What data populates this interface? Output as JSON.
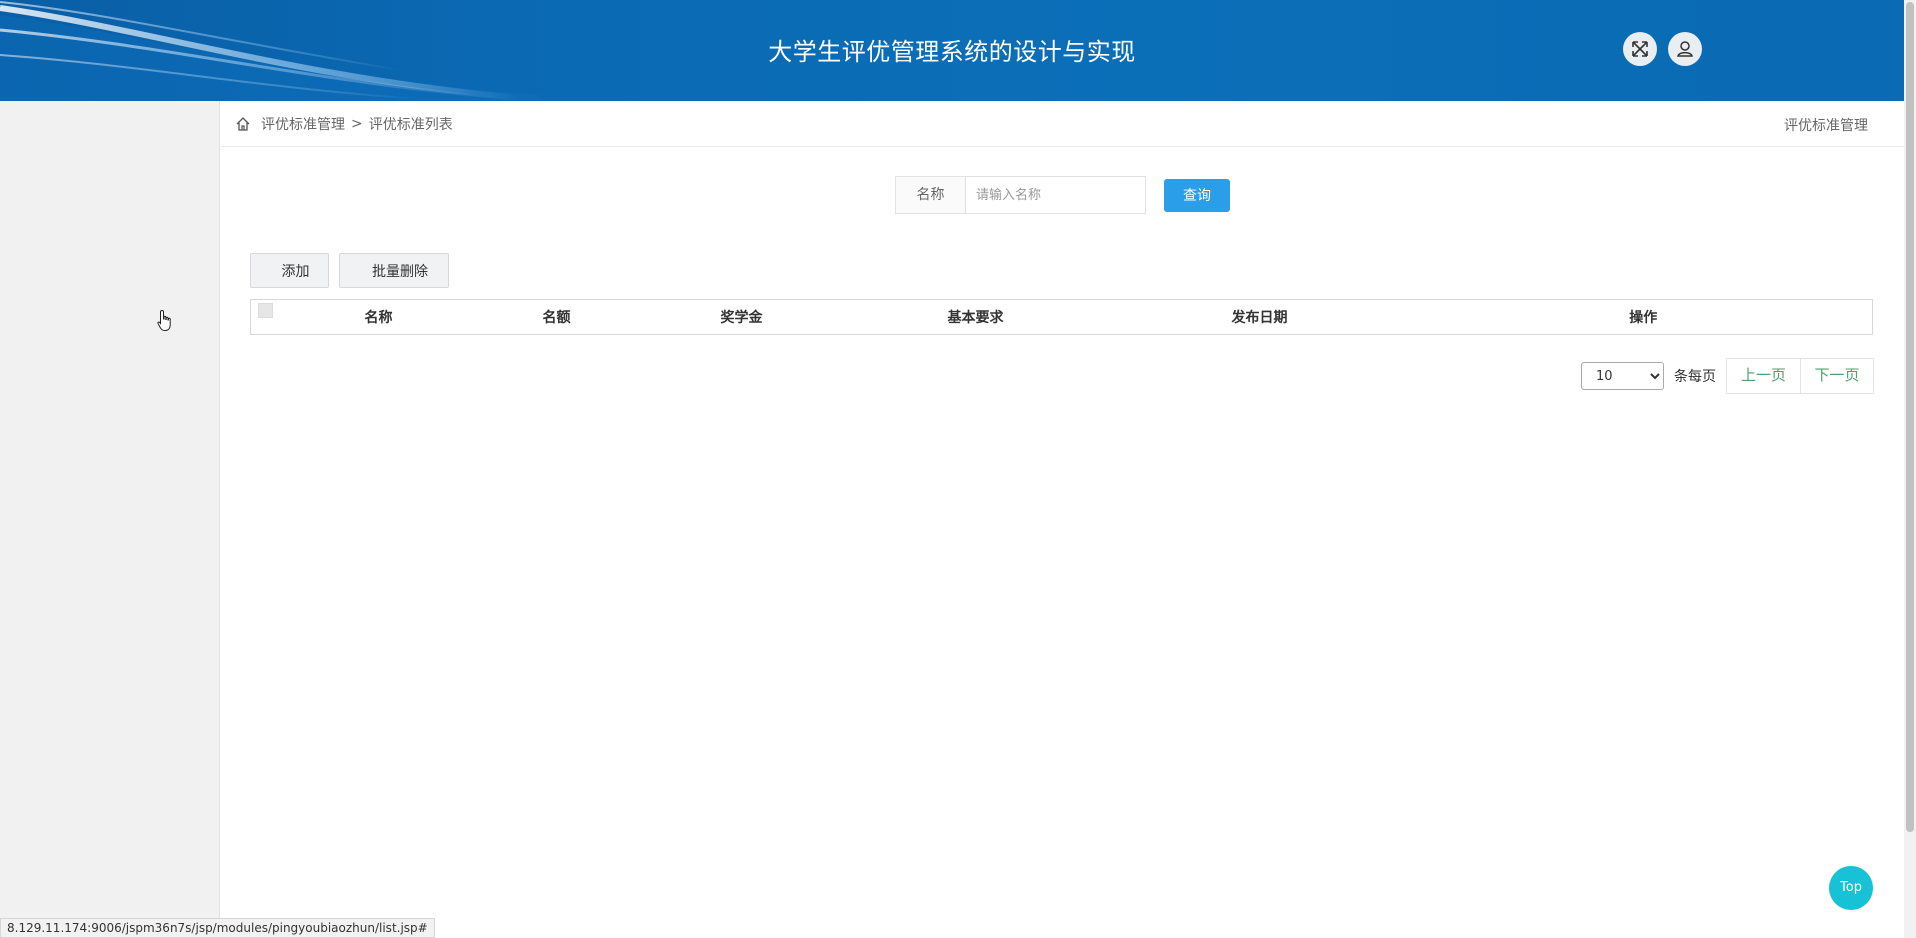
{
  "header": {
    "title": "大学生评优管理系统的设计与实现",
    "expand_icon": "expand-arrows-icon",
    "user_icon": "user-icon",
    "bg_color": "#0b6ab4"
  },
  "breadcrumb": {
    "home_icon": "home-icon",
    "items": [
      "评优标准管理",
      "评优标准列表"
    ],
    "separator": ">",
    "right_title": "评优标准管理"
  },
  "search": {
    "label": "名称",
    "placeholder": "请输入名称",
    "value": "",
    "button": "查询",
    "button_color": "#2a9ee8"
  },
  "actions": {
    "add": "添加",
    "batch_delete": "批量删除"
  },
  "table": {
    "columns": [
      "名称",
      "名额",
      "奖学金",
      "基本要求",
      "发布日期",
      "操作"
    ],
    "rows": []
  },
  "pagination": {
    "page_size": "10",
    "page_size_options": [
      "10"
    ],
    "per_page_label": "条每页",
    "prev": "上一页",
    "next": "下一页",
    "link_color": "#4aa36a"
  },
  "top_button": {
    "label": "Top",
    "color": "#17c2d6"
  },
  "status_bar": {
    "url": "8.129.11.174:9006/jspm36n7s/jsp/modules/pingyoubiaozhun/list.jsp#"
  }
}
